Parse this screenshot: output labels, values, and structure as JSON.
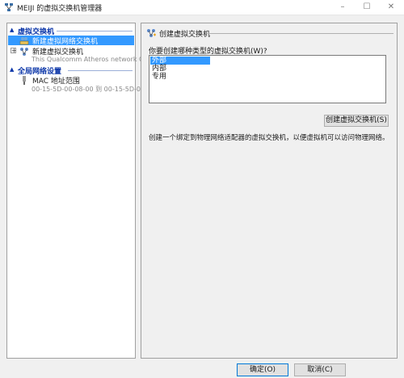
{
  "window": {
    "title": "MEIJI 的虚拟交换机管理器",
    "minimize": "–",
    "maximize": "☐",
    "close": "✕"
  },
  "left": {
    "section1": "虚拟交换机",
    "item_new_virtual": "新建虚拟网络交换机",
    "item_switch": "新建虚拟交换机",
    "item_switch_sub": "This Qualcomm Atheros network C...",
    "section2": "全局网络设置",
    "item_mac": "MAC 地址范围",
    "item_mac_sub": "00-15-5D-00-08-00 到 00-15-5D-0..."
  },
  "right": {
    "header": "创建虚拟交换机",
    "question": "你要创建哪种类型的虚拟交换机(W)?",
    "options": [
      "外部",
      "内部",
      "专用"
    ],
    "selected_index": 0,
    "create_button": "创建虚拟交换机(S)",
    "description": "创建一个绑定到物理网络适配器的虚拟交换机，以便虚拟机可以访问物理网络。"
  },
  "footer": {
    "ok": "确定(O)",
    "cancel": "取消(C)"
  }
}
